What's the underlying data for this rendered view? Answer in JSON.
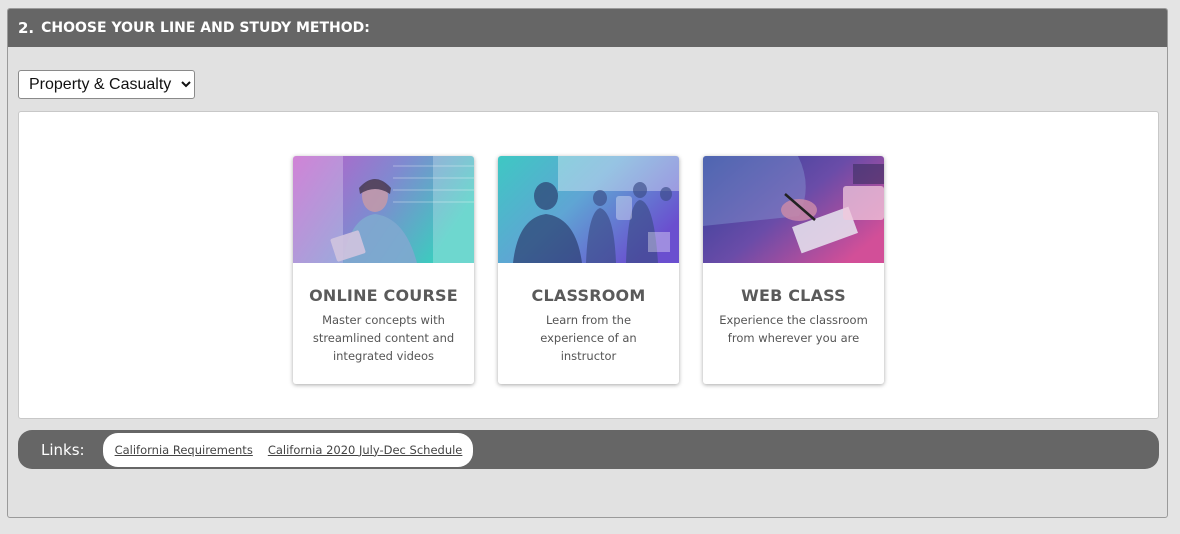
{
  "section": {
    "number": "2.",
    "title": "CHOOSE YOUR LINE AND STUDY METHOD:"
  },
  "line_select": {
    "selected": "Property & Casualty",
    "options": [
      "Property & Casualty"
    ]
  },
  "cards": [
    {
      "title": "ONLINE COURSE",
      "description": "Master concepts with streamlined content and integrated videos",
      "gradient": [
        "#c054c8",
        "#3ec9c0"
      ]
    },
    {
      "title": "CLASSROOM",
      "description": "Learn from the experience of an instructor",
      "gradient": [
        "#3fc6c4",
        "#6a4fd0"
      ]
    },
    {
      "title": "WEB CLASS",
      "description": "Experience the classroom from wherever you are",
      "gradient": [
        "#2a3e96",
        "#d04e9a"
      ]
    }
  ],
  "links": {
    "label": "Links:",
    "items": [
      "California Requirements",
      "California 2020 July-Dec Schedule"
    ]
  },
  "colors": {
    "header_bg": "#666666",
    "panel_bg": "#e1e1e1",
    "card_title": "#5a5a5a"
  }
}
